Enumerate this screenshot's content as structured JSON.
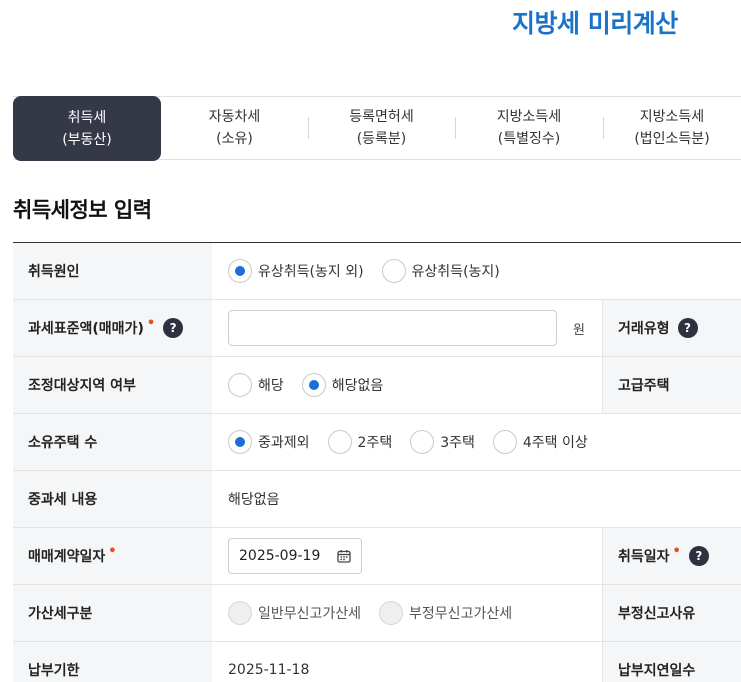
{
  "header": {
    "title": "지방세 미리계산"
  },
  "tabs": [
    {
      "line1": "취득세",
      "line2": "(부동산)",
      "active": true
    },
    {
      "line1": "자동차세",
      "line2": "(소유)",
      "active": false
    },
    {
      "line1": "등록면허세",
      "line2": "(등록분)",
      "active": false
    },
    {
      "line1": "지방소득세",
      "line2": "(특별징수)",
      "active": false
    },
    {
      "line1": "지방소득세",
      "line2": "(법인소득분)",
      "active": false
    }
  ],
  "section": {
    "title": "취득세정보 입력"
  },
  "form": {
    "cause": {
      "label": "취득원인",
      "options": [
        {
          "label": "유상취득(농지 외)",
          "selected": true
        },
        {
          "label": "유상취득(농지)",
          "selected": false
        }
      ]
    },
    "tax_base": {
      "label": "과세표준액(매매가)",
      "help": "?",
      "value": "",
      "unit": "원"
    },
    "deal_type": {
      "label": "거래유형",
      "help": "?"
    },
    "adjusted_area": {
      "label": "조정대상지역 여부",
      "options": [
        {
          "label": "해당",
          "selected": false
        },
        {
          "label": "해당없음",
          "selected": true
        }
      ]
    },
    "luxury_house": {
      "label": "고급주택"
    },
    "house_count": {
      "label": "소유주택 수",
      "options": [
        {
          "label": "중과제외",
          "selected": true
        },
        {
          "label": "2주택",
          "selected": false
        },
        {
          "label": "3주택",
          "selected": false
        },
        {
          "label": "4주택 이상",
          "selected": false
        }
      ]
    },
    "heavy_tax": {
      "label": "중과세 내용",
      "value": "해당없음"
    },
    "contract_date": {
      "label": "매매계약일자",
      "value": "2025-09-19"
    },
    "acquire_date": {
      "label": "취득일자",
      "help": "?"
    },
    "penalty_type": {
      "label": "가산세구분",
      "options": [
        {
          "label": "일반무신고가산세",
          "selected": false
        },
        {
          "label": "부정무신고가산세",
          "selected": false
        }
      ]
    },
    "fraud_reason": {
      "label": "부정신고사유"
    },
    "due_date": {
      "label": "납부기한",
      "value": "2025-11-18"
    },
    "late_days": {
      "label": "납부지연일수"
    }
  },
  "colors": {
    "accent": "#1a73c9",
    "active_tab": "#343847",
    "radio_on": "#1a6fd6",
    "required": "#e8501a"
  }
}
